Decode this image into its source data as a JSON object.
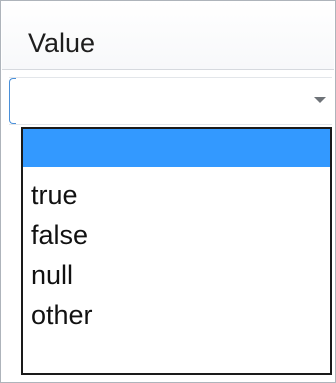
{
  "header": {
    "label": "Value"
  },
  "dropdown": {
    "selected_value": "",
    "options": [
      "",
      "true",
      "false",
      "null",
      "other"
    ]
  },
  "colors": {
    "selection": "#3399ff",
    "focus_border": "#4a90d9"
  }
}
